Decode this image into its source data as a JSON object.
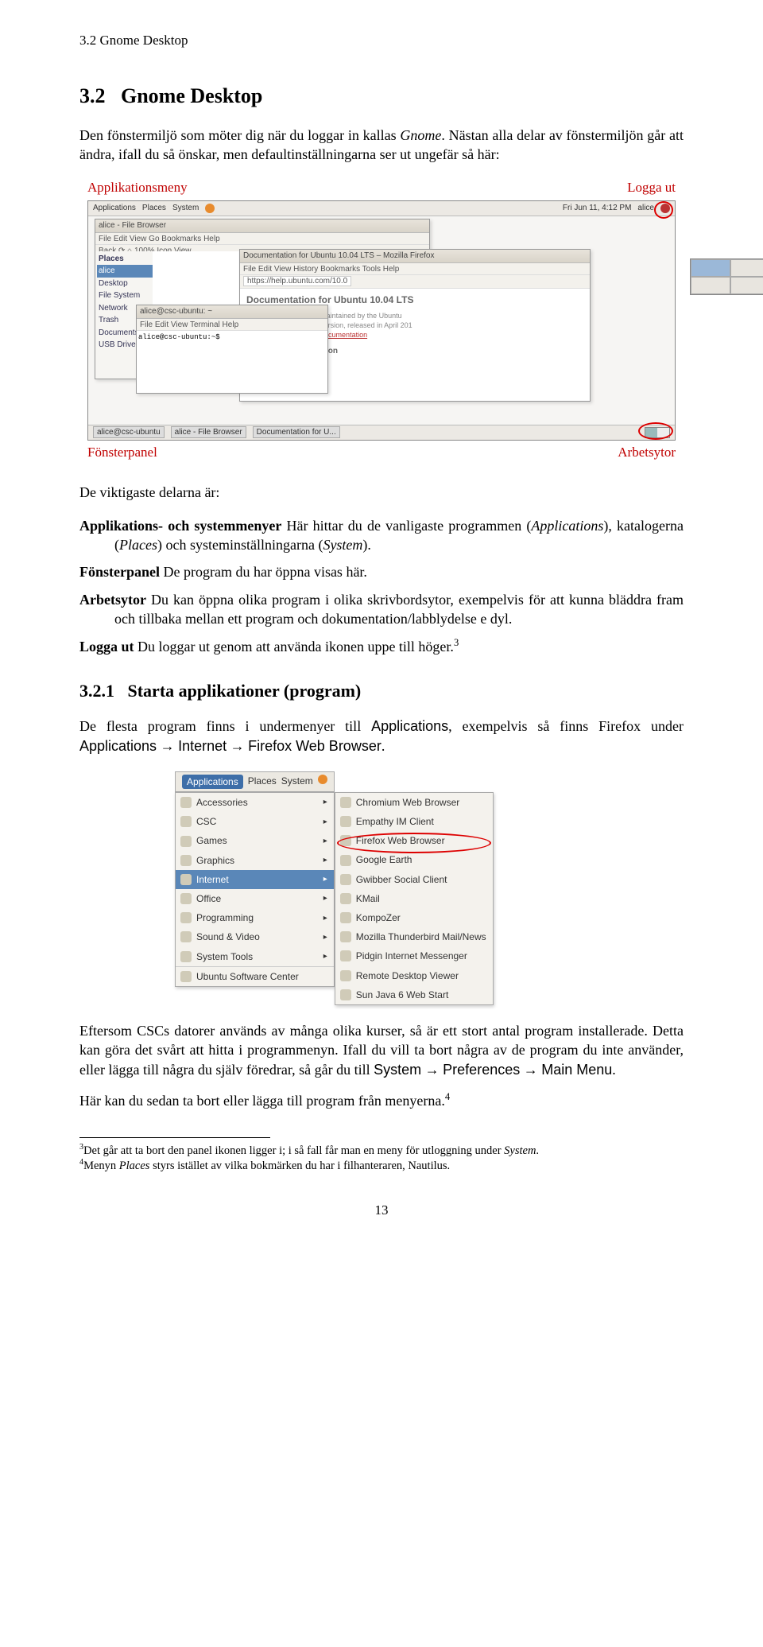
{
  "header": {
    "section_label": "3.2 Gnome Desktop"
  },
  "h2": {
    "number": "3.2",
    "title": "Gnome Desktop"
  },
  "intro": {
    "p1_a": "Den fönstermiljö som möter dig när du loggar in kallas ",
    "p1_em": "Gnome",
    "p1_b": ". Nästan alla delar av fönstermiljön går att ändra, ifall du så önskar, men defaultinställningarna ser ut ungefär så här:"
  },
  "labels": {
    "applikationsmeny": "Applikationsmeny",
    "logga_ut": "Logga ut",
    "fonsterpanel": "Fönsterpanel",
    "arbetsytor": "Arbetsytor"
  },
  "gnome_screenshot": {
    "topbar_left": [
      "Applications",
      "Places",
      "System"
    ],
    "topbar_right": [
      "Fri Jun 11, 4:12 PM",
      "alice"
    ],
    "bottombar_left": [
      "alice@csc-ubuntu",
      "alice - File Browser",
      "Documentation for U..."
    ],
    "filebrowser": {
      "title": "alice - File Browser",
      "menu": "File  Edit  View  Go  Bookmarks  Help",
      "toolbar": "Back  ⟳  ⌂  100%  Icon View",
      "places_header": "Places",
      "places": [
        "alice",
        "Desktop",
        "File System",
        "Network",
        "Trash",
        "Documents",
        "USB Drive"
      ]
    },
    "firefox": {
      "title": "Documentation for Ubuntu 10.04 LTS – Mozilla Firefox",
      "menu": "File  Edit  View  History  Bookmarks  Tools  Help",
      "url": "https://help.ubuntu.com/10.0",
      "body_title": "Documentation for Ubuntu 10.04 LTS",
      "body_lines": [
        "intation developed and maintained by the Ubuntu",
        "10.04, the latest stable version, released in April 201",
        "community contributed documentation"
      ],
      "subhead": "Desktop Documentation"
    },
    "terminal": {
      "title": "alice@csc-ubuntu: ~",
      "menu": "File  Edit  View  Terminal  Help",
      "prompt": "alice@csc-ubuntu:~$"
    }
  },
  "section_list": {
    "heading": "De viktigaste delarna är:",
    "items": [
      {
        "term": "Applikations- och systemmenyer",
        "rest_a": " Här hittar du de vanligaste programmen (",
        "em1": "Applications",
        "rest_b": "), katalogerna (",
        "em2": "Places",
        "rest_c": ") och systeminställningarna (",
        "em3": "System",
        "rest_d": ")."
      },
      {
        "term": "Fönsterpanel",
        "rest_a": " De program du har öppna visas här."
      },
      {
        "term": "Arbetsytor",
        "rest_a": " Du kan öppna olika program i olika skrivbordsytor, exempelvis för att kunna bläddra fram och tillbaka mellan ett program och dokumentation/labblydelse e dyl."
      },
      {
        "term": "Logga ut",
        "rest_a": " Du loggar ut genom att använda ikonen uppe till höger.",
        "sup": "3"
      }
    ]
  },
  "h3": {
    "number": "3.2.1",
    "title": "Starta applikationer (program)"
  },
  "start_apps": {
    "p_a": "De flesta program finns i undermenyer till ",
    "s1": "Applications",
    "p_b": ", exempelvis så finns Firefox under ",
    "s2": "Applications",
    "arrow": " → ",
    "s3": "Internet",
    "s4": "Firefox Web Browser",
    "p_c": "."
  },
  "menu": {
    "root": [
      "Applications",
      "Places",
      "System"
    ],
    "col1": [
      {
        "label": "Accessories",
        "arrow": true
      },
      {
        "label": "CSC",
        "arrow": true
      },
      {
        "label": "Games",
        "arrow": true
      },
      {
        "label": "Graphics",
        "arrow": true
      },
      {
        "label": "Internet",
        "arrow": true,
        "selected": true
      },
      {
        "label": "Office",
        "arrow": true
      },
      {
        "label": "Programming",
        "arrow": true
      },
      {
        "label": "Sound & Video",
        "arrow": true
      },
      {
        "label": "System Tools",
        "arrow": true
      },
      {
        "label": "Ubuntu Software Center",
        "arrow": false,
        "sep": true
      }
    ],
    "col2": [
      {
        "label": "Chromium Web Browser"
      },
      {
        "label": "Empathy IM Client"
      },
      {
        "label": "Firefox Web Browser",
        "circled": true
      },
      {
        "label": "Google Earth"
      },
      {
        "label": "Gwibber Social Client"
      },
      {
        "label": "KMail"
      },
      {
        "label": "KompoZer"
      },
      {
        "label": "Mozilla Thunderbird Mail/News"
      },
      {
        "label": "Pidgin Internet Messenger"
      },
      {
        "label": "Remote Desktop Viewer"
      },
      {
        "label": "Sun Java 6 Web Start"
      }
    ]
  },
  "after_menu": {
    "p1": "Eftersom CSCs datorer används av många olika kurser, så är ett stort antal program installerade. Detta kan göra det svårt att hitta i programmenyn. Ifall du vill ta bort några av de program du inte använder, eller lägga till några du själv föredrar, så går du till ",
    "s1": "System",
    "arrow": " → ",
    "s2": "Preferences",
    "s3": "Main Menu",
    "p1b": ".",
    "p2": "Här kan du sedan ta bort eller lägga till program från menyerna.",
    "sup": "4"
  },
  "footnotes": {
    "n3_a": "Det går att ta bort den panel ikonen ligger i; i så fall får man en meny för utloggning under ",
    "n3_em": "System",
    "n3_b": ".",
    "n4_a": "Menyn ",
    "n4_em": "Places",
    "n4_b": " styrs istället av vilka bokmärken du har i filhanteraren, Nautilus."
  },
  "page_no": "13"
}
